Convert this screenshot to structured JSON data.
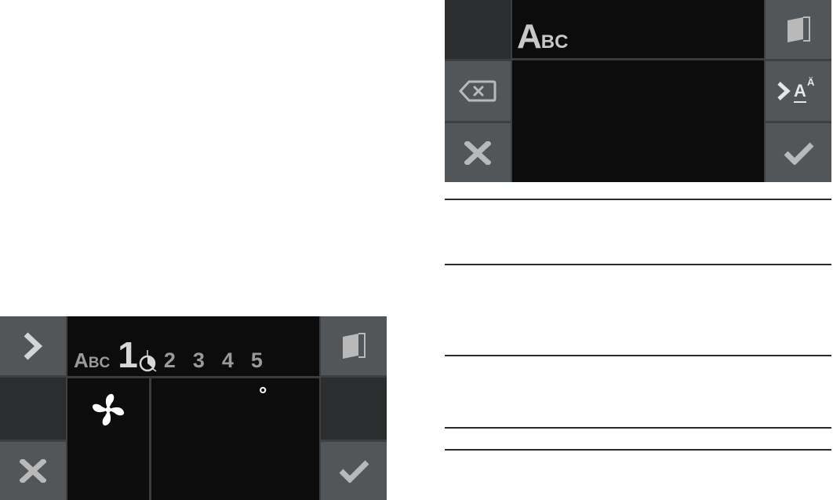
{
  "keyboard_screen": {
    "input_label": {
      "big": "A",
      "small": "BC"
    },
    "buttons": {
      "backspace": "backspace-icon",
      "cancel": "close-icon",
      "book": "book-icon",
      "char_select": {
        "arrow": "chevron-right-icon",
        "letter": "A",
        "accent": "Ä"
      },
      "confirm": "check-icon"
    }
  },
  "fan_screen": {
    "tabs": {
      "abc": {
        "big": "A",
        "small": "BC"
      },
      "active": "1",
      "items": [
        "2",
        "3",
        "4",
        "5"
      ]
    },
    "degree_symbol": "°",
    "buttons": {
      "next": "chevron-right-icon",
      "book": "book-icon",
      "cancel": "close-icon",
      "confirm": "check-icon"
    }
  },
  "colors": {
    "button_light": "#535659",
    "button_dark": "#2b2d2f",
    "screen": "#0c0c0c",
    "divider": "#2a2a2a"
  }
}
